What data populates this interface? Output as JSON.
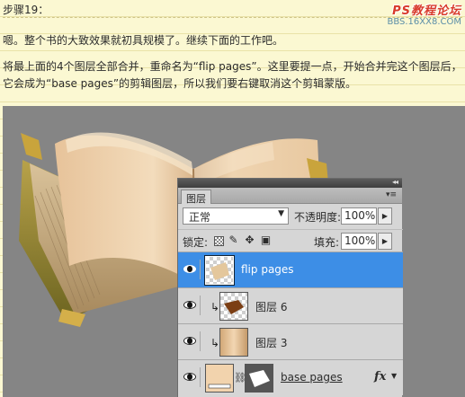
{
  "article": {
    "step_title": "步骤19：",
    "paragraph_1": "嗯。整个书的大致效果就初具规模了。继续下面的工作吧。",
    "paragraph_2": "将最上面的4个图层全部合并，重命名为“flip pages”。这里要提一点，开始合并完这个图层后，它会成为“base pages”的剪辑图层，所以我们要右键取消这个剪辑蒙版。"
  },
  "watermark": {
    "title": "PS教程论坛",
    "url": "BBS.16XX8.COM"
  },
  "layers_panel": {
    "tab_label": "图层",
    "blend_mode": "正常",
    "opacity_label": "不透明度:",
    "opacity_value": "100%",
    "lock_label": "锁定:",
    "fill_label": "填充:",
    "fill_value": "100%",
    "layers": [
      {
        "name": "flip pages",
        "selected": true,
        "clipped": false
      },
      {
        "name": "图层 6",
        "selected": false,
        "clipped": true
      },
      {
        "name": "图层 3",
        "selected": false,
        "clipped": true
      },
      {
        "name": "base pages",
        "selected": false,
        "clipped": false,
        "has_mask": true,
        "has_effects": true
      }
    ],
    "effects_label": "fx"
  },
  "colors": {
    "selected_layer": "#3d8ee6",
    "canvas_background": "#858585",
    "page_background": "#fbf8d2"
  }
}
